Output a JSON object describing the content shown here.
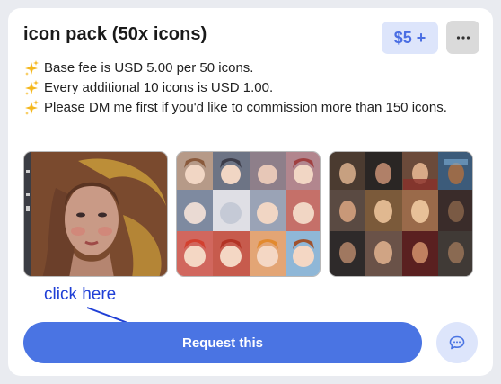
{
  "listing": {
    "title": "icon pack (50x icons)",
    "price_label": "$5 +",
    "more_icon": "ellipsis-icon",
    "description": [
      "Base fee is USD 5.00 per 50 icons.",
      "Every additional 10 icons is USD 1.00.",
      "Please DM me first if you'd like to commission more than 150 icons."
    ],
    "bullet_icon": "sparkles-icon",
    "gallery_icons": [
      "painted-portrait-image",
      "anime-icon-collage-image",
      "photo-icon-collage-image"
    ]
  },
  "annotation": {
    "text": "click here"
  },
  "actions": {
    "request_label": "Request this",
    "chat_icon": "chat-bubble-icon"
  },
  "colors": {
    "accent": "#4a74e3",
    "badge_bg": "#dde5fb",
    "annotation": "#1f3fd6"
  }
}
